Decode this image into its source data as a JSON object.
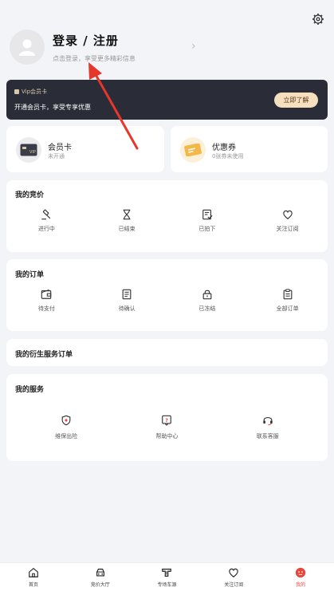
{
  "profile": {
    "title": "登录 / 注册",
    "subtitle": "点击登录，享受更多精彩信息",
    "chevron": "›"
  },
  "membership_banner": {
    "tag": "Vip会员卡",
    "tagline": "开通会员卡，享受专享优惠",
    "cta": "立即了解"
  },
  "cards": [
    {
      "title": "会员卡",
      "subtitle": "未开通",
      "icon": "vip-card-icon"
    },
    {
      "title": "优惠券",
      "subtitle": "0张券未使用",
      "icon": "coupon-icon"
    }
  ],
  "bidding": {
    "title": "我的竞价",
    "items": [
      {
        "label": "进行中",
        "icon": "gavel-icon"
      },
      {
        "label": "已结束",
        "icon": "hourglass-icon"
      },
      {
        "label": "已拍下",
        "icon": "won-document-icon"
      },
      {
        "label": "关注订阅",
        "icon": "heart-icon"
      }
    ]
  },
  "orders": {
    "title": "我的订单",
    "items": [
      {
        "label": "待支付",
        "icon": "wallet-icon"
      },
      {
        "label": "待确认",
        "icon": "confirm-document-icon"
      },
      {
        "label": "已冻结",
        "icon": "lock-icon"
      },
      {
        "label": "全部订单",
        "icon": "clipboard-icon"
      }
    ]
  },
  "derived_orders": {
    "title": "我的衍生服务订单"
  },
  "services": {
    "title": "我的服务",
    "items": [
      {
        "label": "维保出险",
        "icon": "shield-icon"
      },
      {
        "label": "帮助中心",
        "icon": "help-icon"
      },
      {
        "label": "联系客服",
        "icon": "headset-icon"
      }
    ]
  },
  "tabbar": {
    "items": [
      {
        "label": "首页",
        "icon": "home-icon"
      },
      {
        "label": "竞价大厅",
        "icon": "bidding-hall-icon"
      },
      {
        "label": "专场车源",
        "icon": "special-source-icon"
      },
      {
        "label": "关注订阅",
        "icon": "heart-icon"
      },
      {
        "label": "我的",
        "icon": "profile-icon",
        "active": true
      }
    ]
  },
  "colors": {
    "accent": "#e8453c",
    "banner_bg": "#2a2d38",
    "banner_button": "#f5dfbe",
    "page_bg": "#f3f4f8",
    "annotation_arrow": "#e5372c"
  }
}
